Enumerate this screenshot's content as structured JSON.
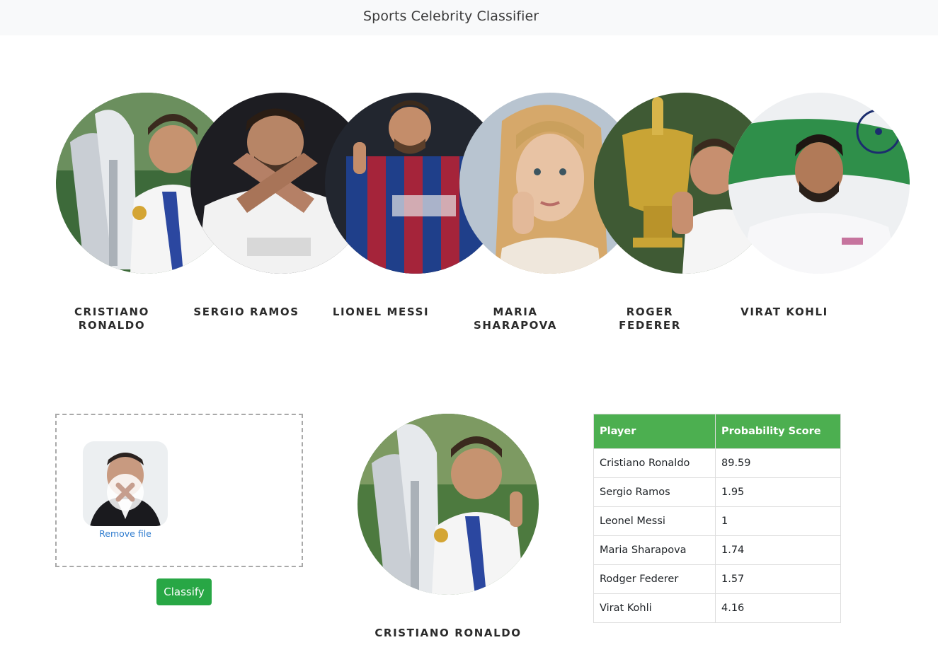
{
  "navbar": {
    "brand": "Sports Celebrity Classifier"
  },
  "celebrities": [
    {
      "name": "CRISTIANO RONALDO",
      "icon": "player-photo"
    },
    {
      "name": "SERGIO RAMOS",
      "icon": "player-photo"
    },
    {
      "name": "LIONEL MESSI",
      "icon": "player-photo"
    },
    {
      "name": "MARIA SHARAPOVA",
      "icon": "player-photo"
    },
    {
      "name": "ROGER FEDERER",
      "icon": "player-photo"
    },
    {
      "name": "VIRAT KOHLI",
      "icon": "player-photo"
    }
  ],
  "upload": {
    "remove_label": "Remove file",
    "remove_icon": "close-icon"
  },
  "classify": {
    "label": "Classify",
    "color": "#28a745"
  },
  "result": {
    "name": "CRISTIANO RONALDO"
  },
  "table": {
    "header_color": "#4caf50",
    "columns": [
      "Player",
      "Probability Score"
    ],
    "rows": [
      [
        "Cristiano Ronaldo",
        "89.59"
      ],
      [
        "Sergio Ramos",
        "1.95"
      ],
      [
        "Leonel Messi",
        "1"
      ],
      [
        "Maria Sharapova",
        "1.74"
      ],
      [
        "Rodger Federer",
        "1.57"
      ],
      [
        "Virat Kohli",
        "4.16"
      ]
    ]
  }
}
